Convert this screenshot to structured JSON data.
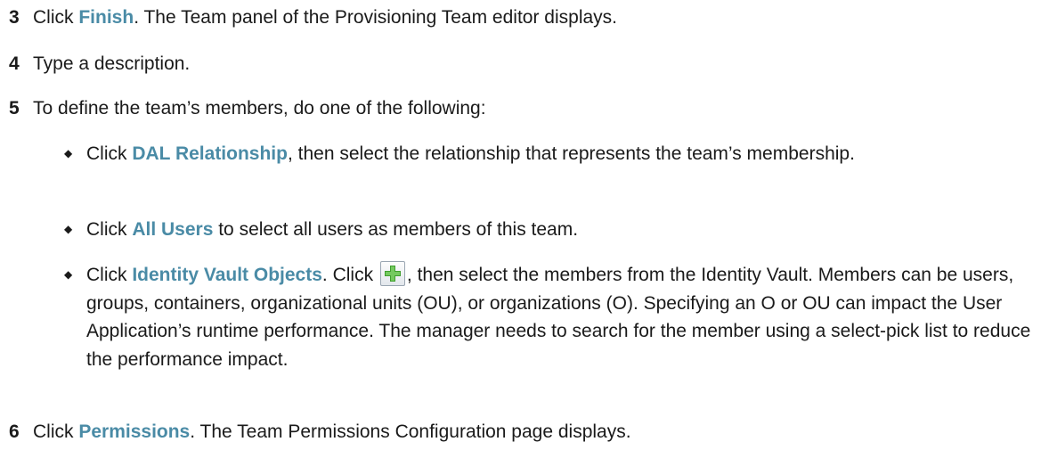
{
  "steps": [
    {
      "num": "3",
      "pre": "Click ",
      "ui": "Finish",
      "post": ". The Team panel of the Provisioning Team editor displays."
    },
    {
      "num": "4",
      "text": "Type a description."
    },
    {
      "num": "5",
      "text": "To define the team’s members, do one of the following:"
    },
    {
      "num": "6",
      "pre": "Click ",
      "ui": "Permissions",
      "post": ". The Team Permissions Configuration page displays."
    }
  ],
  "bullets": [
    {
      "pre": "Click ",
      "ui": "DAL Relationship",
      "post": ", then select the relationship that represents the team’s membership."
    },
    {
      "pre": "Click ",
      "ui": "All Users",
      "post": " to select all users as members of this team."
    },
    {
      "pre": "Click ",
      "ui": "Identity Vault Objects",
      "mid": ". Click ",
      "post": ", then select the members from the Identity Vault. Members can be users, groups, containers, organizational units (OU), or organizations (O). Specifying an O or OU can impact the User Application’s runtime performance. The manager needs to search for the member using a select-pick list to reduce the performance impact."
    }
  ],
  "icons": {
    "add_object": "add-plus-icon",
    "bullet": "diamond-bullet-icon"
  },
  "colors": {
    "ui_reference": "#4a8ba6",
    "add_icon_plus": "#3f9e2e"
  }
}
